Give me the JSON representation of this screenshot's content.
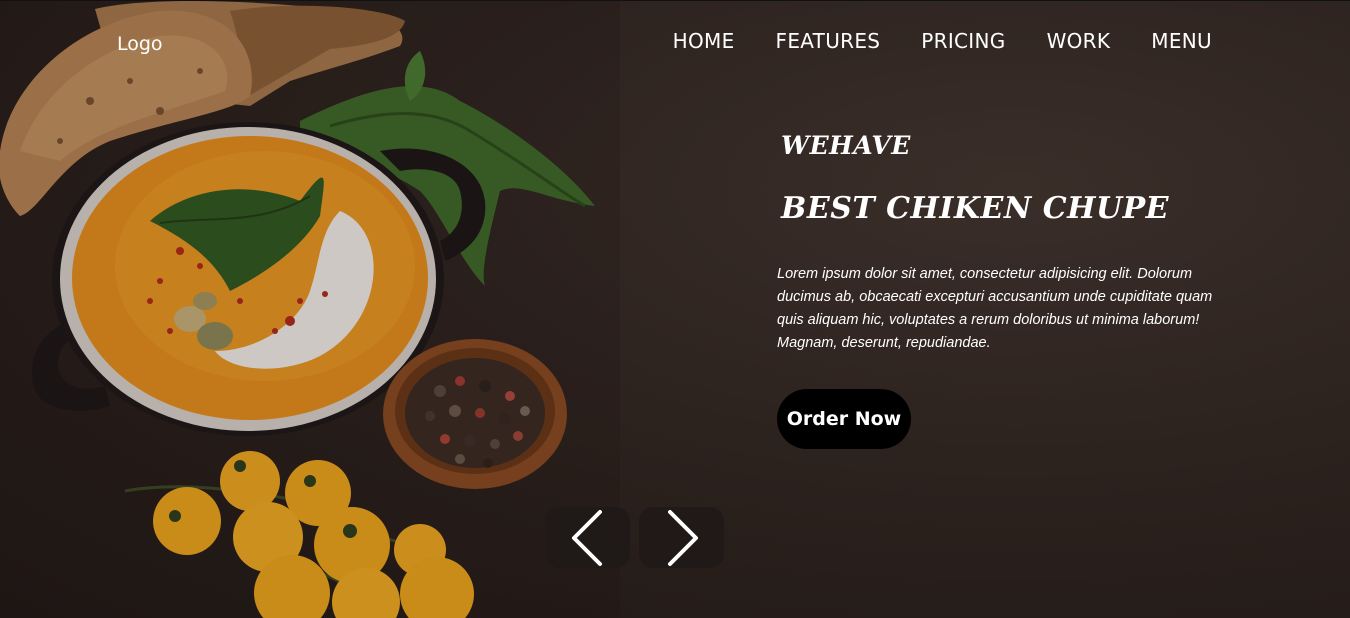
{
  "header": {
    "logo": "Logo",
    "nav": [
      {
        "label": "HOME"
      },
      {
        "label": "FEATURES"
      },
      {
        "label": "PRICING"
      },
      {
        "label": "WORK"
      },
      {
        "label": "MENU"
      }
    ]
  },
  "hero": {
    "kicker": "WEHAVE",
    "title": "BEST CHIKEN CHUPE",
    "body": "Lorem ipsum dolor sit amet, consectetur adipisicing elit. Dolorum ducimus ab, obcaecati excepturi accusantium unde cupiditate quam quis aliquam hic, voluptates a rerum doloribus ut minima laborum! Magnam, deserunt, repudiandae.",
    "cta_label": "Order Now"
  },
  "slider": {
    "prev_icon": "chevron-left-icon",
    "next_icon": "chevron-right-icon"
  },
  "colors": {
    "background": "#2c221e",
    "text": "#ffffff",
    "button": "#000000",
    "soup": "#e8921a",
    "tomato": "#f0a81c"
  }
}
